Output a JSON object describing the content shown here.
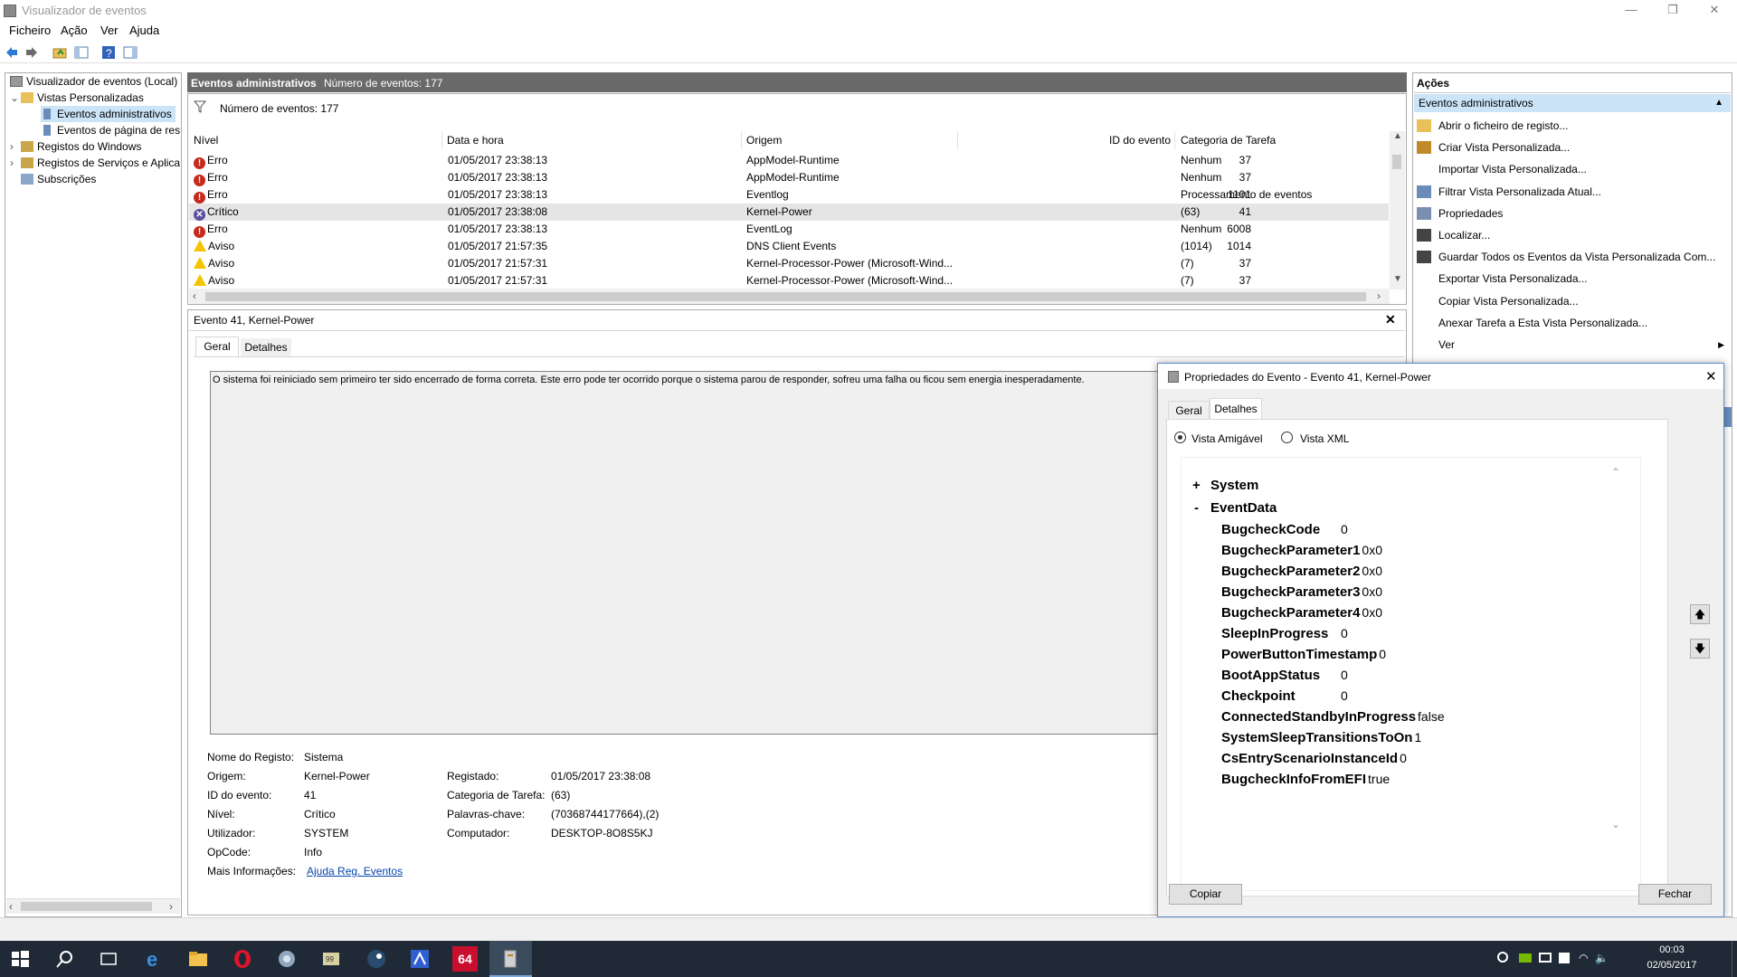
{
  "window": {
    "title": "Visualizador de eventos",
    "btn_min": "—",
    "btn_max": "❐",
    "btn_close": "✕"
  },
  "menu": [
    "Ficheiro",
    "Ação",
    "Ver",
    "Ajuda"
  ],
  "tree": {
    "root": "Visualizador de eventos (Local)",
    "custom_views": "Vistas Personalizadas",
    "admin_events": "Eventos administrativos",
    "page_events": "Eventos de página de res",
    "windows_logs": "Registos do Windows",
    "app_logs": "Registos de Serviços e Aplica",
    "subscriptions": "Subscrições"
  },
  "center": {
    "header_title": "Eventos administrativos",
    "header_count": "Número de eventos: 177",
    "filter_text": "Número de eventos: 177",
    "columns": [
      "Nível",
      "Data e hora",
      "Origem",
      "ID do evento",
      "Categoria de Tarefa"
    ],
    "rows": [
      {
        "level": "Erro",
        "type": "err",
        "date": "01/05/2017 23:38:13",
        "source": "AppModel-Runtime",
        "id": "37",
        "category": "Nenhum"
      },
      {
        "level": "Erro",
        "type": "err",
        "date": "01/05/2017 23:38:13",
        "source": "AppModel-Runtime",
        "id": "37",
        "category": "Nenhum"
      },
      {
        "level": "Erro",
        "type": "err",
        "date": "01/05/2017 23:38:13",
        "source": "Eventlog",
        "id": "1101",
        "category": "Processamento de eventos"
      },
      {
        "level": "Crítico",
        "type": "crit",
        "date": "01/05/2017 23:38:08",
        "source": "Kernel-Power",
        "id": "41",
        "category": "(63)"
      },
      {
        "level": "Erro",
        "type": "err",
        "date": "01/05/2017 23:38:13",
        "source": "EventLog",
        "id": "6008",
        "category": "Nenhum"
      },
      {
        "level": "Aviso",
        "type": "warn",
        "date": "01/05/2017 21:57:35",
        "source": "DNS Client Events",
        "id": "1014",
        "category": "(1014)"
      },
      {
        "level": "Aviso",
        "type": "warn",
        "date": "01/05/2017 21:57:31",
        "source": "Kernel-Processor-Power (Microsoft-Wind...",
        "id": "37",
        "category": "(7)"
      },
      {
        "level": "Aviso",
        "type": "warn",
        "date": "01/05/2017 21:57:31",
        "source": "Kernel-Processor-Power (Microsoft-Wind...",
        "id": "37",
        "category": "(7)"
      }
    ]
  },
  "detail": {
    "title": "Evento 41, Kernel-Power",
    "tab_general": "Geral",
    "tab_details": "Detalhes",
    "message": "O sistema foi reiniciado sem primeiro ter sido encerrado de forma correta. Este erro pode ter ocorrido porque o sistema parou de responder, sofreu uma falha ou ficou sem energia inesperadamente.",
    "log_name_label": "Nome do Registo:",
    "log_name": "Sistema",
    "source_label": "Origem:",
    "source": "Kernel-Power",
    "logged_label": "Registado:",
    "logged": "01/05/2017 23:38:08",
    "event_id_label": "ID do evento:",
    "event_id": "41",
    "task_cat_label": "Categoria de Tarefa:",
    "task_cat": "(63)",
    "level_label": "Nível:",
    "level": "Crítico",
    "keywords_label": "Palavras-chave:",
    "keywords": "(70368744177664),(2)",
    "user_label": "Utilizador:",
    "user": "SYSTEM",
    "computer_label": "Computador:",
    "computer": "DESKTOP-8O8S5KJ",
    "opcode_label": "OpCode:",
    "opcode": "Info",
    "more_label": "Mais Informações:",
    "more_link": "Ajuda Reg. Eventos"
  },
  "actions": {
    "header": "Ações",
    "section": "Eventos administrativos",
    "items": [
      "Abrir o ficheiro de registo...",
      "Criar Vista Personalizada...",
      "Importar Vista Personalizada...",
      "Filtrar Vista Personalizada Atual...",
      "Propriedades",
      "Localizar...",
      "Guardar Todos os Eventos da Vista Personalizada Com...",
      "Exportar Vista Personalizada...",
      "Copiar Vista Personalizada...",
      "Anexar Tarefa a Esta Vista Personalizada...",
      "Ver"
    ]
  },
  "dialog": {
    "title": "Propriedades do Evento - Evento 41, Kernel-Power",
    "tab_general": "Geral",
    "tab_details": "Detalhes",
    "radio_friendly": "Vista Amigável",
    "radio_xml": "Vista XML",
    "system_label": "System",
    "system_toggle": "+",
    "eventdata_label": "EventData",
    "eventdata_toggle": "-",
    "fields": [
      {
        "k": "BugcheckCode",
        "v": "0"
      },
      {
        "k": "BugcheckParameter1",
        "v": "0x0"
      },
      {
        "k": "BugcheckParameter2",
        "v": "0x0"
      },
      {
        "k": "BugcheckParameter3",
        "v": "0x0"
      },
      {
        "k": "BugcheckParameter4",
        "v": "0x0"
      },
      {
        "k": "SleepInProgress",
        "v": "0"
      },
      {
        "k": "PowerButtonTimestamp",
        "v": "0"
      },
      {
        "k": "BootAppStatus",
        "v": "0"
      },
      {
        "k": "Checkpoint",
        "v": "0"
      },
      {
        "k": "ConnectedStandbyInProgress",
        "v": "false"
      },
      {
        "k": "SystemSleepTransitionsToOn",
        "v": "1"
      },
      {
        "k": "CsEntryScenarioInstanceId",
        "v": "0"
      },
      {
        "k": "BugcheckInfoFromEFI",
        "v": "true"
      }
    ],
    "copy_button": "Copiar",
    "close_button": "Fechar"
  },
  "taskbar": {
    "time": "00:03",
    "date": "02/05/2017",
    "badge": "64"
  }
}
